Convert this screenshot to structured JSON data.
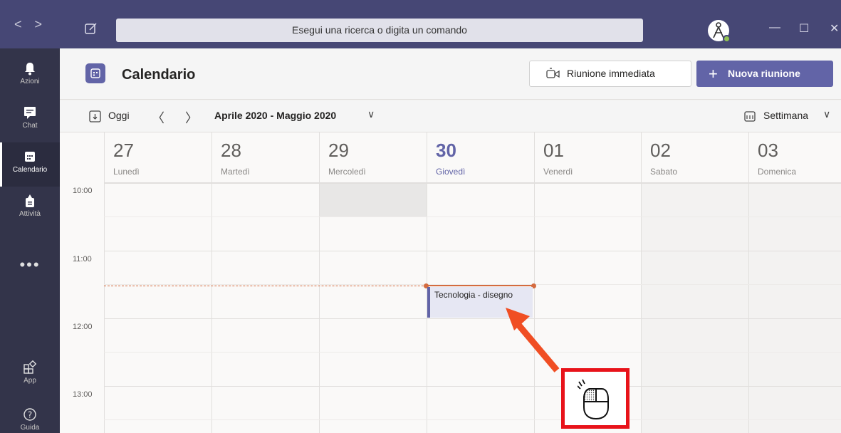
{
  "titlebar": {
    "nav_back": "<",
    "nav_forward": ">",
    "search_placeholder": "Esegui una ricerca o digita un comando",
    "window_minimize": "—",
    "window_maximize": "☐",
    "window_close": "✕"
  },
  "rail": {
    "items": [
      {
        "label": "Azioni",
        "icon": "bell-icon"
      },
      {
        "label": "Chat",
        "icon": "chat-icon"
      },
      {
        "label": "Calendario",
        "icon": "calendar-icon",
        "active": true
      },
      {
        "label": "Attività",
        "icon": "assignments-icon"
      },
      {
        "label": "App",
        "icon": "apps-icon"
      },
      {
        "label": "Guida",
        "icon": "help-icon"
      }
    ],
    "more": "•••"
  },
  "header": {
    "title": "Calendario",
    "meet_now_label": "Riunione immediata",
    "new_meeting_label": "Nuova riunione"
  },
  "toolbar": {
    "today_label": "Oggi",
    "prev": "〈",
    "next": "〉",
    "range": "Aprile 2020 - Maggio 2020",
    "view_label": "Settimana",
    "chevron": "∨"
  },
  "days": [
    {
      "num": "27",
      "name": "Lunedì"
    },
    {
      "num": "28",
      "name": "Martedì"
    },
    {
      "num": "29",
      "name": "Mercoledì"
    },
    {
      "num": "30",
      "name": "Giovedì",
      "today": true
    },
    {
      "num": "01",
      "name": "Venerdì"
    },
    {
      "num": "02",
      "name": "Sabato"
    },
    {
      "num": "03",
      "name": "Domenica"
    }
  ],
  "times": [
    "10:00",
    "11:00",
    "12:00",
    "13:00"
  ],
  "event": {
    "title": "Tecnologia - disegno"
  },
  "colors": {
    "titlebar": "#464775",
    "rail": "#33344a",
    "accent": "#6264a7",
    "now_line": "#d46b3f",
    "annotation": "#e8131a"
  }
}
